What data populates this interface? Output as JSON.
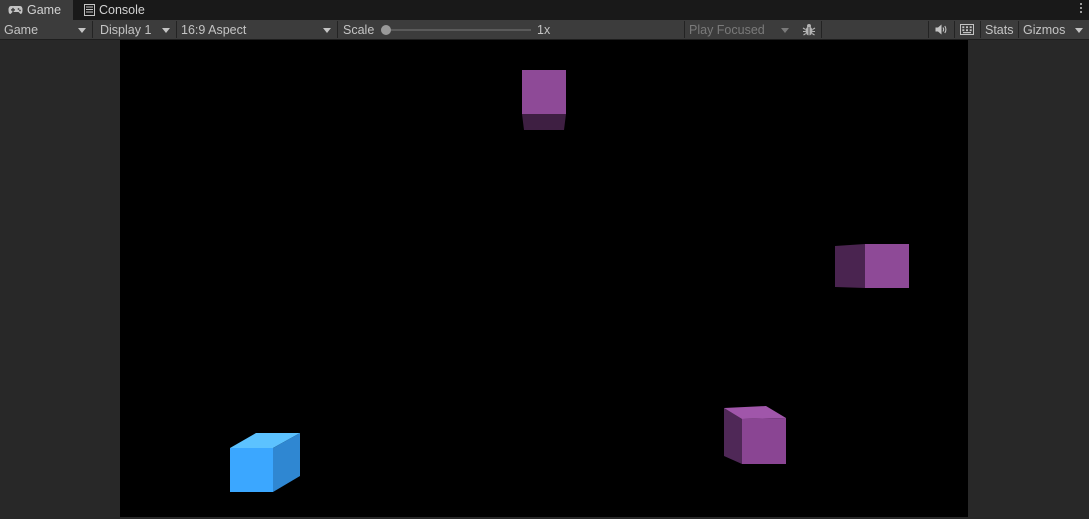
{
  "tabs": [
    {
      "label": "Game",
      "icon": "gamepad-icon",
      "active": true
    },
    {
      "label": "Console",
      "icon": "console-icon",
      "active": false
    }
  ],
  "toolbar": {
    "view_mode": "Game",
    "display": "Display 1",
    "aspect": "16:9 Aspect",
    "scale_label": "Scale",
    "scale_value": "1x",
    "play_mode": "Play Focused",
    "stats_label": "Stats",
    "gizmos_label": "Gizmos"
  },
  "icons": {
    "bug": "bug-icon",
    "audio": "speaker-icon",
    "keyboard": "keyboard-icon",
    "menu": "kebab-menu-icon"
  },
  "colors": {
    "cube_blue": "#3ba7ff",
    "cube_purple": "#8e4a97",
    "background": "#000000",
    "editor_bg": "#282828"
  }
}
